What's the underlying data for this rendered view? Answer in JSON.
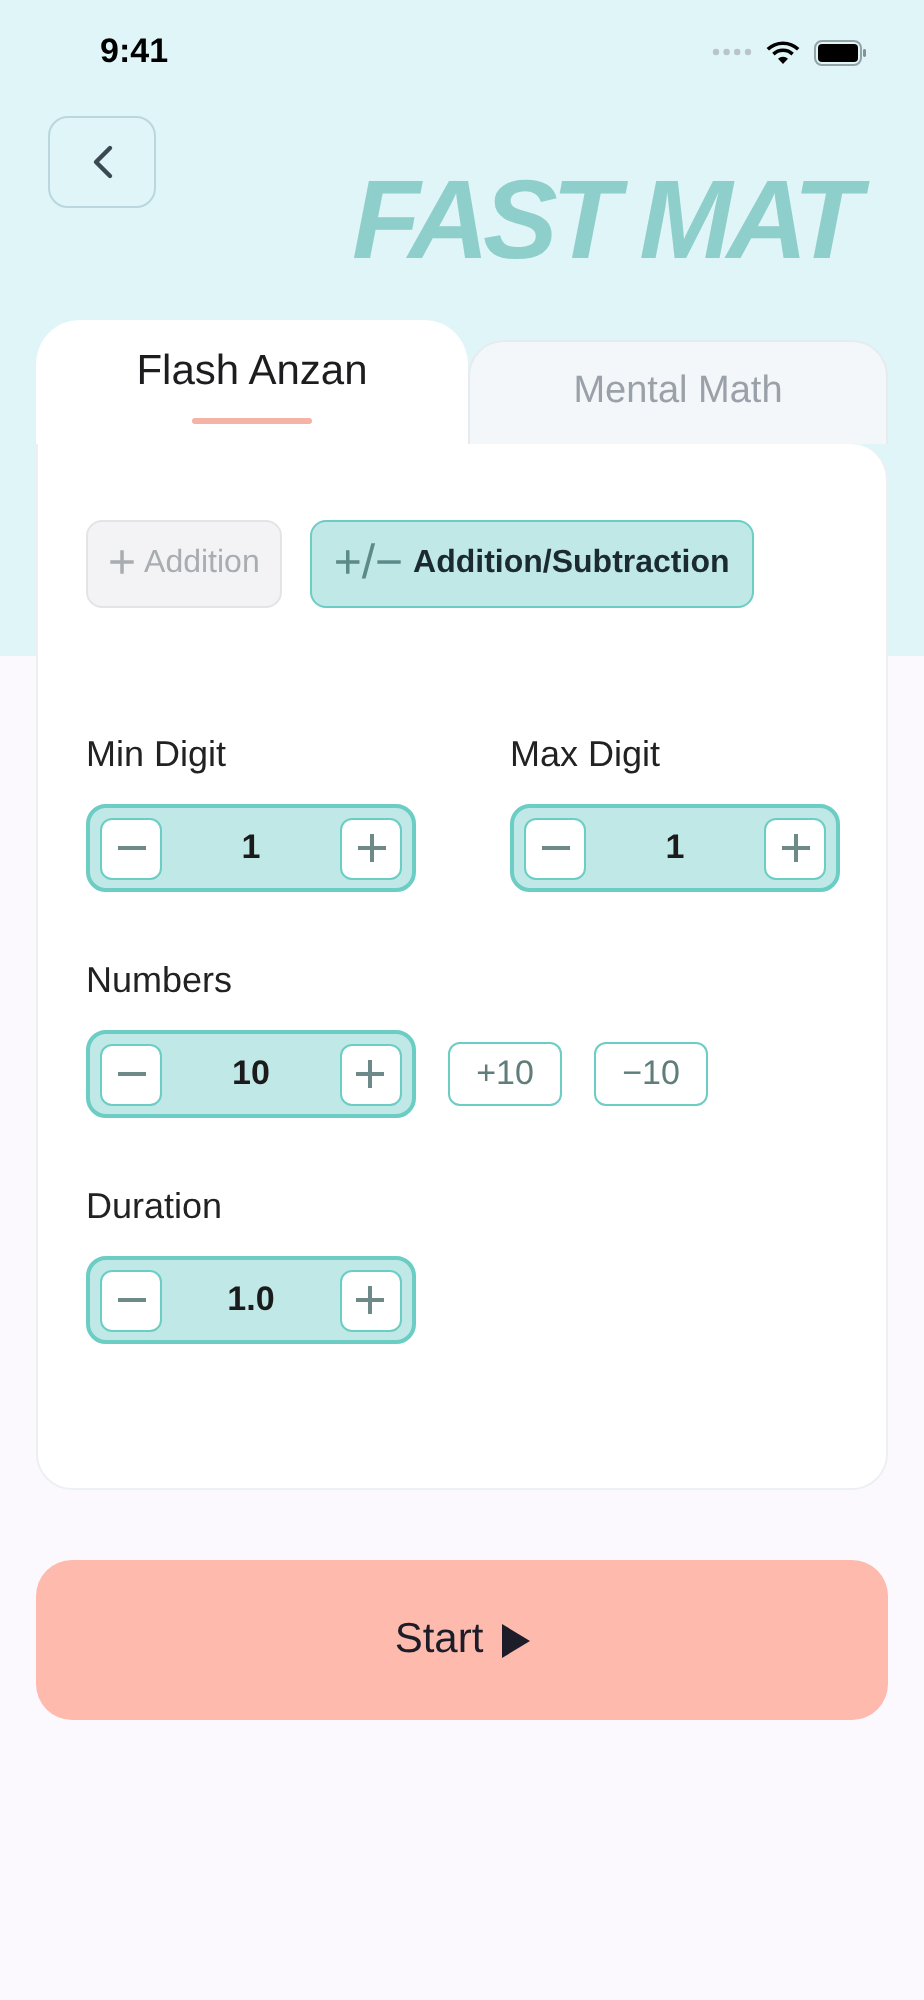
{
  "status_bar": {
    "time": "9:41"
  },
  "banner": {
    "title": "FAST MAT"
  },
  "tabs": [
    {
      "label": "Flash Anzan",
      "selected": true
    },
    {
      "label": "Mental Math",
      "selected": false
    }
  ],
  "modes": [
    {
      "symbol": "+",
      "label": "Addition",
      "selected": false
    },
    {
      "symbol": "+/−",
      "label": "Addition/Subtraction",
      "selected": true
    }
  ],
  "settings": [
    {
      "label": "Min Digit",
      "value": "1"
    },
    {
      "label": "Max Digit",
      "value": "1"
    },
    {
      "label": "Numbers",
      "value": "10",
      "quick_buttons": [
        "+10",
        "−10"
      ]
    },
    {
      "label": "Duration",
      "value": "1.0"
    }
  ],
  "start_button": {
    "label": "Start"
  }
}
